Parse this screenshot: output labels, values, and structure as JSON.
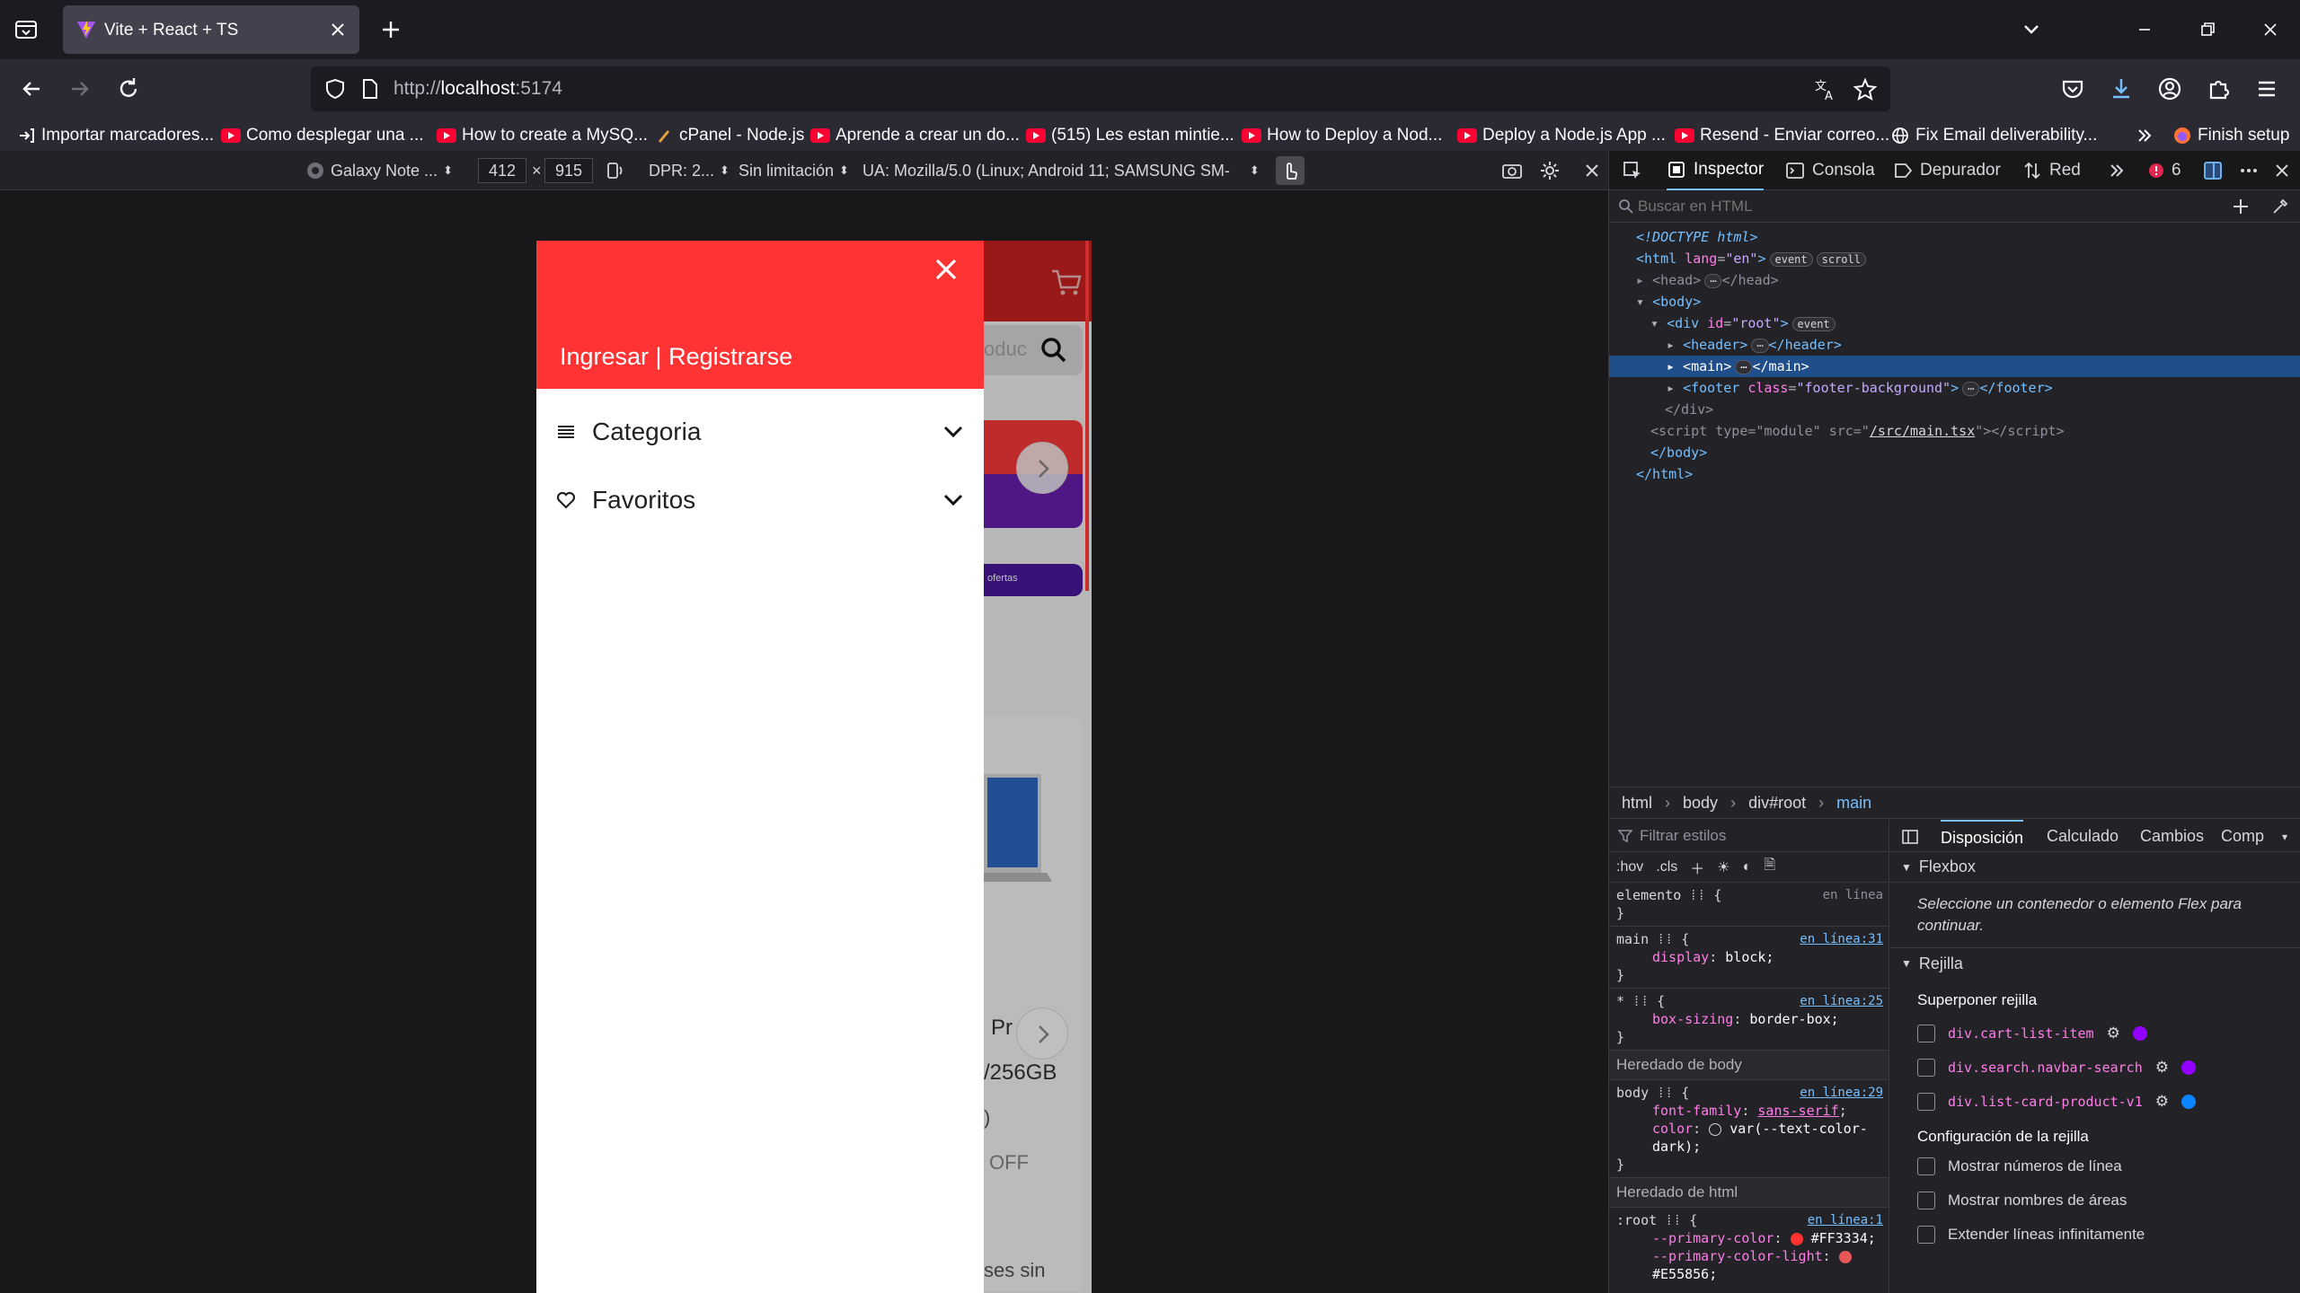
{
  "browser": {
    "tab_title": "Vite + React + TS",
    "url_prefix": "http://",
    "url_host": "localhost",
    "url_port": ":5174"
  },
  "bookmarks": [
    "Importar marcadores...",
    "Como desplegar una ...",
    "How to create a MySQ...",
    "cPanel - Node.js",
    "Aprende a crear un do...",
    "(515) Les estan mintie...",
    "How to Deploy a Nod...",
    "Deploy a Node.js App ...",
    "Resend - Enviar correo...",
    "Fix Email deliverability...",
    "Finish setup"
  ],
  "rdm": {
    "device": "Galaxy Note ...",
    "width": "412",
    "times": "×",
    "height": "915",
    "dpr": "DPR: 2...",
    "throttle": "Sin limitación",
    "ua": "UA: Mozilla/5.0 (Linux; Android 11; SAMSUNG SM-"
  },
  "app": {
    "drawer_auth": "Ingresar | Registrarse",
    "menu": [
      {
        "label": "Categoria",
        "icon": "list-icon"
      },
      {
        "label": "Favoritos",
        "icon": "heart-icon"
      }
    ],
    "bg_texts": [
      "Pr",
      "/256GB",
      ")",
      "OFF",
      "ses sin"
    ],
    "search_placeholder": "oduc",
    "banner_text": "ofertas",
    "primary_color": "#FF3334"
  },
  "devtools": {
    "tabs": [
      "Inspector",
      "Consola",
      "Depurador",
      "Red"
    ],
    "error_count": "6",
    "search_placeholder": "Buscar en HTML",
    "breadcrumbs": [
      "html",
      "body",
      "div#root",
      "main"
    ],
    "styles_filter": "Filtrar estilos",
    "tools": [
      ":hov",
      ".cls"
    ],
    "layout_tabs": [
      "Disposición",
      "Calculado",
      "Cambios",
      "Comp"
    ],
    "flexbox_title": "Flexbox",
    "flex_hint": "Seleccione un contenedor o elemento Flex para continuar.",
    "grid_title": "Rejilla",
    "overlay_label": "Superponer rejilla",
    "grids": [
      {
        "name": "div.cart-list-item",
        "color": "#9400ff"
      },
      {
        "name": "div.search.navbar-search",
        "color": "#9400ff"
      },
      {
        "name": "div.list-card-product-v1",
        "color": "#0a84ff"
      }
    ],
    "grid_config_label": "Configuración de la rejilla",
    "grid_options": [
      "Mostrar números de línea",
      "Mostrar nombres de áreas",
      "Extender líneas infinitamente"
    ],
    "rules": {
      "element": "elemento",
      "element_src": "en línea",
      "main_sel": "main",
      "main_src": "en línea:31",
      "main_prop": "display",
      "main_val": "block;",
      "star_sel": "*",
      "star_src": "en línea:25",
      "star_prop": "box-sizing",
      "star_val": "border-box;",
      "inherit_body": "Heredado de body",
      "body_sel": "body",
      "body_src": "en línea:29",
      "body_prop1": "font-family",
      "body_val1": "sans-serif",
      "body_prop2": "color",
      "body_val2": "var(--text-color-dark);",
      "inherit_html": "Heredado de html",
      "root_sel": ":root",
      "root_src": "en línea:1",
      "root_prop1": "--primary-color",
      "root_val1": "#FF3334;",
      "root_prop2": "--primary-color-light",
      "root_val2": "#E55856;"
    }
  }
}
